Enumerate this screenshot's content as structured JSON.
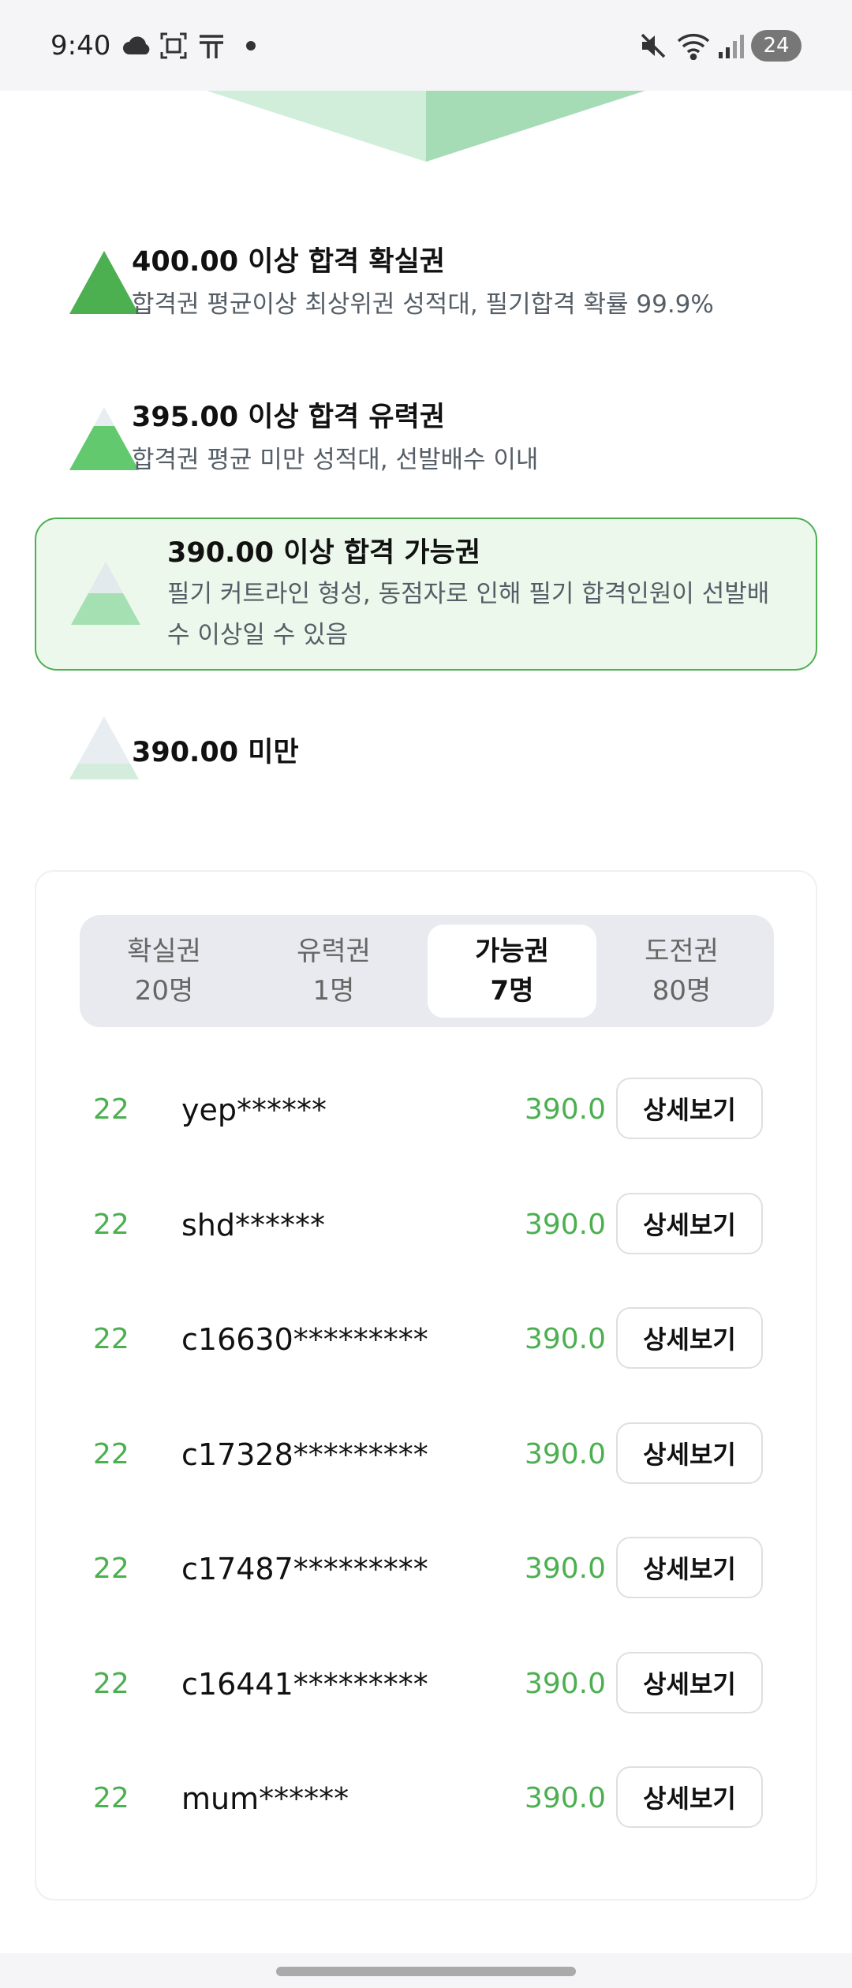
{
  "status_bar": {
    "time": "9:40",
    "icons": [
      "cloud-icon",
      "screenshot-icon",
      "t-app-icon",
      "dot-icon",
      "mute-icon",
      "wifi-icon",
      "signal-icon"
    ],
    "battery": "24"
  },
  "tiers": [
    {
      "title": "400.00 이상 합격 확실권",
      "desc": "합격권 평균이상 최상위권 성적대, 필기합격 확률 99.9%"
    },
    {
      "title": "395.00 이상 합격 유력권",
      "desc": "합격권 평균 미만 성적대, 선발배수 이내"
    },
    {
      "title": "390.00 이상 합격 가능권",
      "desc": "필기 커트라인 형성, 동점자로 인해 필기 합격인원이 선발배수 이상일 수 있음",
      "selected": true
    },
    {
      "title": "390.00 미만",
      "desc": ""
    }
  ],
  "tabs": [
    {
      "label": "확실권",
      "count": "20명",
      "active": false
    },
    {
      "label": "유력권",
      "count": "1명",
      "active": false
    },
    {
      "label": "가능권",
      "count": "7명",
      "active": true
    },
    {
      "label": "도전권",
      "count": "80명",
      "active": false
    }
  ],
  "rows": [
    {
      "rank": "22",
      "name": "yep******",
      "score": "390.0",
      "button": "상세보기"
    },
    {
      "rank": "22",
      "name": "shd******",
      "score": "390.0",
      "button": "상세보기"
    },
    {
      "rank": "22",
      "name": "c16630*********",
      "score": "390.0",
      "button": "상세보기"
    },
    {
      "rank": "22",
      "name": "c17328*********",
      "score": "390.0",
      "button": "상세보기"
    },
    {
      "rank": "22",
      "name": "c17487*********",
      "score": "390.0",
      "button": "상세보기"
    },
    {
      "rank": "22",
      "name": "c16441*********",
      "score": "390.0",
      "button": "상세보기"
    },
    {
      "rank": "22",
      "name": "mum******",
      "score": "390.0",
      "button": "상세보기"
    }
  ],
  "colors": {
    "accent": "#4caf50",
    "highlight_bg": "#ecf8ec",
    "tab_bg": "#e9eaef"
  }
}
